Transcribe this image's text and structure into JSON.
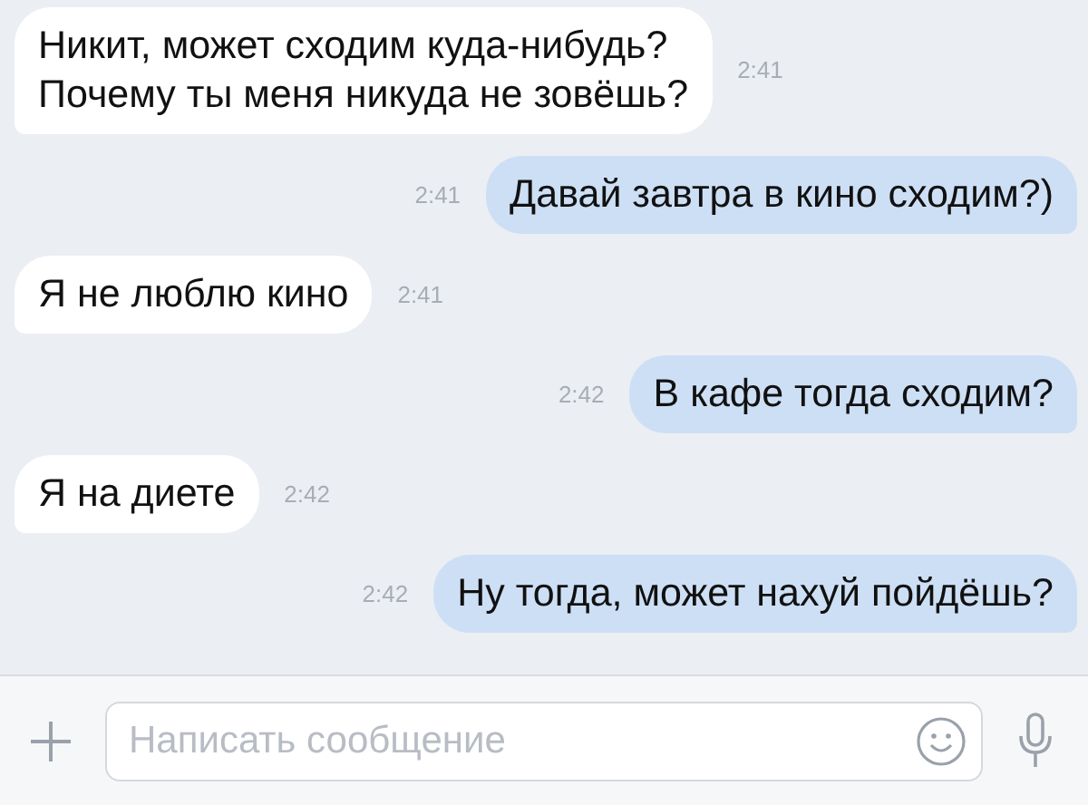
{
  "messages": [
    {
      "kind": "incoming",
      "text": "Никит, может сходим куда-нибудь?\nПочему ты меня никуда не зовёшь?",
      "time": "2:41"
    },
    {
      "kind": "outgoing",
      "text": "Давай завтра в кино сходим?)",
      "time": "2:41"
    },
    {
      "kind": "incoming",
      "text": "Я не люблю кино",
      "time": "2:41"
    },
    {
      "kind": "outgoing",
      "text": "В кафе тогда сходим?",
      "time": "2:42"
    },
    {
      "kind": "incoming",
      "text": "Я на диете",
      "time": "2:42"
    },
    {
      "kind": "outgoing",
      "text": "Ну тогда, может нахуй пойдёшь?",
      "time": "2:42"
    }
  ],
  "composer": {
    "placeholder": "Написать сообщение"
  }
}
